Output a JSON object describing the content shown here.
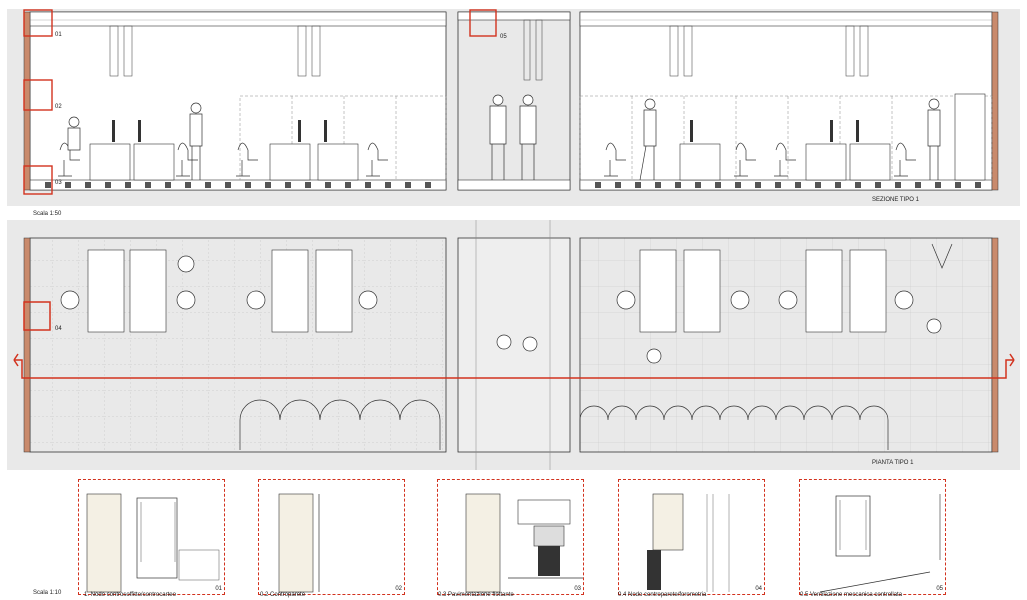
{
  "section": {
    "title": "SEZIONE TIPO 1",
    "scale": "Scala 1:50",
    "markers": [
      "01",
      "02",
      "03",
      "05"
    ]
  },
  "plan": {
    "title": "PIANTA TIPO 1",
    "marker": "04"
  },
  "details": {
    "scale": "Scala 1:10",
    "items": [
      {
        "caption": "1.   Nodo controsoffitto/controcarteo",
        "num": "01"
      },
      {
        "caption": "0.2  Controparete",
        "num": "02"
      },
      {
        "caption": "0.3 Pavimentazione flottante",
        "num": "03"
      },
      {
        "caption": "0.4 Nodo controparete/forometria",
        "num": "04"
      },
      {
        "caption": "0.5 Ventilazione meccanica controllata",
        "num": "05"
      }
    ]
  },
  "colors": {
    "accent": "#d2321e",
    "background_band": "#e9e9e9",
    "line": "#333333"
  }
}
